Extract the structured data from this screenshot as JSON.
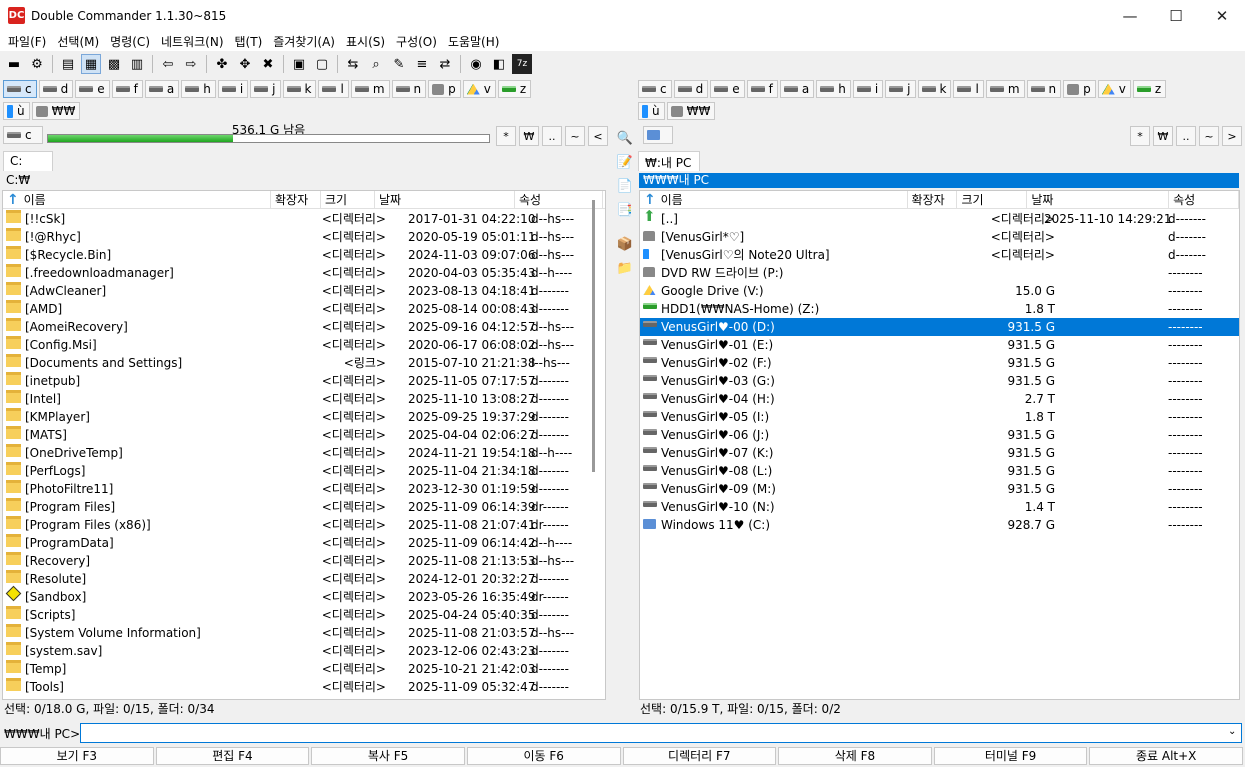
{
  "window": {
    "title": "Double Commander 1.1.30~815",
    "app_icon": "DC"
  },
  "menu": [
    "파일(F)",
    "선택(M)",
    "명령(C)",
    "네트워크(N)",
    "탭(T)",
    "즐겨찾기(A)",
    "표시(S)",
    "구성(O)",
    "도움말(H)"
  ],
  "toolbar_icons": [
    "terminal-icon",
    "settings-icon",
    "brief-view-icon",
    "columns-view-icon",
    "thumbnails-view-icon",
    "flat-view-icon",
    "sync-left-icon",
    "sync-right-icon",
    "copy-icon",
    "move-icon",
    "delete-icon",
    "pack-icon",
    "unpack-icon",
    "compare-icon",
    "search-icon",
    "edit-icon",
    "multi-rename-icon",
    "sync-dirs-icon",
    "torrent-icon",
    "notes-icon",
    "7zip-icon"
  ],
  "left": {
    "drives_row1": [
      {
        "label": "c",
        "sel": true
      },
      {
        "label": "d"
      },
      {
        "label": "e"
      },
      {
        "label": "f"
      },
      {
        "label": "a"
      },
      {
        "label": "h"
      },
      {
        "label": "i"
      },
      {
        "label": "j"
      },
      {
        "label": "k"
      },
      {
        "label": "l"
      },
      {
        "label": "m"
      },
      {
        "label": "n"
      },
      {
        "label": "p",
        "icon": "net"
      },
      {
        "label": "v",
        "icon": "gd"
      },
      {
        "label": "z",
        "icon": "green"
      }
    ],
    "drives_row2": [
      {
        "label": "ù",
        "icon": "usb"
      },
      {
        "label": "₩₩",
        "icon": "net"
      }
    ],
    "current_drive": "c",
    "free_space": "536.1 G 남음",
    "free_fraction": 0.42,
    "path_buttons": [
      "*",
      "₩",
      "..",
      "~",
      "<"
    ],
    "tab": "C:",
    "current_path": "C:₩",
    "columns": [
      "이름",
      "확장자",
      "크기",
      "날짜",
      "속성"
    ],
    "rows": [
      {
        "name": "[!!cSk]",
        "size": "<디렉터리>",
        "date": "2017-01-31 04:22:10",
        "attr": "d--hs---"
      },
      {
        "name": "[!@Rhyc]",
        "size": "<디렉터리>",
        "date": "2020-05-19 05:01:11",
        "attr": "d--hs---"
      },
      {
        "name": "[$Recycle.Bin]",
        "size": "<디렉터리>",
        "date": "2024-11-03 09:07:06",
        "attr": "d--hs---"
      },
      {
        "name": "[.freedownloadmanager]",
        "size": "<디렉터리>",
        "date": "2020-04-03 05:35:43",
        "attr": "d--h----"
      },
      {
        "name": "[AdwCleaner]",
        "size": "<디렉터리>",
        "date": "2023-08-13 04:18:41",
        "attr": "d-------"
      },
      {
        "name": "[AMD]",
        "size": "<디렉터리>",
        "date": "2025-08-14 00:08:43",
        "attr": "d-------"
      },
      {
        "name": "[AomeiRecovery]",
        "size": "<디렉터리>",
        "date": "2025-09-16 04:12:57",
        "attr": "d--hs---"
      },
      {
        "name": "[Config.Msi]",
        "size": "<디렉터리>",
        "date": "2020-06-17 06:08:02",
        "attr": "d--hs---"
      },
      {
        "name": "[Documents and Settings]",
        "size": "<링크>",
        "date": "2015-07-10 21:21:38",
        "attr": "l--hs---"
      },
      {
        "name": "[inetpub]",
        "size": "<디렉터리>",
        "date": "2025-11-05 07:17:57",
        "attr": "d-------"
      },
      {
        "name": "[Intel]",
        "size": "<디렉터리>",
        "date": "2025-11-10 13:08:27",
        "attr": "d-------"
      },
      {
        "name": "[KMPlayer]",
        "size": "<디렉터리>",
        "date": "2025-09-25 19:37:29",
        "attr": "d-------"
      },
      {
        "name": "[MATS]",
        "size": "<디렉터리>",
        "date": "2025-04-04 02:06:27",
        "attr": "d-------"
      },
      {
        "name": "[OneDriveTemp]",
        "size": "<디렉터리>",
        "date": "2024-11-21 19:54:18",
        "attr": "d--h----"
      },
      {
        "name": "[PerfLogs]",
        "size": "<디렉터리>",
        "date": "2025-11-04 21:34:18",
        "attr": "d-------"
      },
      {
        "name": "[PhotoFiltre11]",
        "size": "<디렉터리>",
        "date": "2023-12-30 01:19:59",
        "attr": "d-------"
      },
      {
        "name": "[Program Files]",
        "size": "<디렉터리>",
        "date": "2025-11-09 06:14:39",
        "attr": "dr------"
      },
      {
        "name": "[Program Files (x86)]",
        "size": "<디렉터리>",
        "date": "2025-11-08 21:07:41",
        "attr": "dr------"
      },
      {
        "name": "[ProgramData]",
        "size": "<디렉터리>",
        "date": "2025-11-09 06:14:42",
        "attr": "d--h----"
      },
      {
        "name": "[Recovery]",
        "size": "<디렉터리>",
        "date": "2025-11-08 21:13:53",
        "attr": "d--hs---"
      },
      {
        "name": "[Resolute]",
        "size": "<디렉터리>",
        "date": "2024-12-01 20:32:27",
        "attr": "d-------"
      },
      {
        "name": "[Sandbox]",
        "size": "<디렉터리>",
        "date": "2023-05-26 16:35:49",
        "attr": "dr------",
        "icon": "sandbox"
      },
      {
        "name": "[Scripts]",
        "size": "<디렉터리>",
        "date": "2025-04-24 05:40:35",
        "attr": "d-------"
      },
      {
        "name": "[System Volume Information]",
        "size": "<디렉터리>",
        "date": "2025-11-08 21:03:57",
        "attr": "d--hs---"
      },
      {
        "name": "[system.sav]",
        "size": "<디렉터리>",
        "date": "2023-12-06 02:43:23",
        "attr": "d-------"
      },
      {
        "name": "[Temp]",
        "size": "<디렉터리>",
        "date": "2025-10-21 21:42:03",
        "attr": "d-------"
      },
      {
        "name": "[Tools]",
        "size": "<디렉터리>",
        "date": "2025-11-09 05:32:47",
        "attr": "d-------"
      }
    ],
    "status": "선택: 0/18.0 G, 파일: 0/15, 폴더: 0/34"
  },
  "right": {
    "drives_row1": [
      {
        "label": "c"
      },
      {
        "label": "d"
      },
      {
        "label": "e"
      },
      {
        "label": "f"
      },
      {
        "label": "a"
      },
      {
        "label": "h"
      },
      {
        "label": "i"
      },
      {
        "label": "j"
      },
      {
        "label": "k"
      },
      {
        "label": "l"
      },
      {
        "label": "m"
      },
      {
        "label": "n"
      },
      {
        "label": "p",
        "icon": "net"
      },
      {
        "label": "v",
        "icon": "gd"
      },
      {
        "label": "z",
        "icon": "green"
      }
    ],
    "drives_row2": [
      {
        "label": "ù",
        "icon": "usb"
      },
      {
        "label": "₩₩",
        "icon": "net"
      }
    ],
    "path_buttons": [
      "*",
      "₩",
      "..",
      "~",
      ">"
    ],
    "tab": "₩:내 PC",
    "current_path": "₩₩₩내 PC",
    "columns": [
      "이름",
      "확장자",
      "크기",
      "날짜",
      "속성"
    ],
    "rows": [
      {
        "name": "[..]",
        "size": "<디렉터리>",
        "date": "2025-11-10 14:29:21",
        "attr": "d-------",
        "icon": "up"
      },
      {
        "name": "[VenusGirl*♡]",
        "size": "<디렉터리>",
        "date": "",
        "attr": "d-------",
        "icon": "net"
      },
      {
        "name": "[VenusGirl♡의 Note20 Ultra]",
        "size": "<디렉터리>",
        "date": "",
        "attr": "d-------",
        "icon": "usb"
      },
      {
        "name": "DVD RW 드라이브 (P:)",
        "size": "",
        "date": "",
        "attr": "--------",
        "icon": "net"
      },
      {
        "name": "Google Drive (V:)",
        "size": "15.0 G",
        "date": "",
        "attr": "--------",
        "icon": "gd"
      },
      {
        "name": "HDD1(₩₩NAS-Home) (Z:)",
        "size": "1.8 T",
        "date": "",
        "attr": "--------",
        "icon": "green"
      },
      {
        "name": "VenusGirl♥-00 (D:)",
        "size": "931.5 G",
        "date": "",
        "attr": "--------",
        "icon": "drive",
        "sel": true
      },
      {
        "name": "VenusGirl♥-01 (E:)",
        "size": "931.5 G",
        "date": "",
        "attr": "--------",
        "icon": "drive"
      },
      {
        "name": "VenusGirl♥-02 (F:)",
        "size": "931.5 G",
        "date": "",
        "attr": "--------",
        "icon": "drive"
      },
      {
        "name": "VenusGirl♥-03 (G:)",
        "size": "931.5 G",
        "date": "",
        "attr": "--------",
        "icon": "drive"
      },
      {
        "name": "VenusGirl♥-04 (H:)",
        "size": "2.7 T",
        "date": "",
        "attr": "--------",
        "icon": "drive"
      },
      {
        "name": "VenusGirl♥-05 (I:)",
        "size": "1.8 T",
        "date": "",
        "attr": "--------",
        "icon": "drive"
      },
      {
        "name": "VenusGirl♥-06 (J:)",
        "size": "931.5 G",
        "date": "",
        "attr": "--------",
        "icon": "drive"
      },
      {
        "name": "VenusGirl♥-07 (K:)",
        "size": "931.5 G",
        "date": "",
        "attr": "--------",
        "icon": "drive"
      },
      {
        "name": "VenusGirl♥-08 (L:)",
        "size": "931.5 G",
        "date": "",
        "attr": "--------",
        "icon": "drive"
      },
      {
        "name": "VenusGirl♥-09 (M:)",
        "size": "931.5 G",
        "date": "",
        "attr": "--------",
        "icon": "drive"
      },
      {
        "name": "VenusGirl♥-10 (N:)",
        "size": "1.4 T",
        "date": "",
        "attr": "--------",
        "icon": "drive"
      },
      {
        "name": "Windows 11♥ (C:)",
        "size": "928.7 G",
        "date": "",
        "attr": "--------",
        "icon": "pc"
      }
    ],
    "status": "선택: 0/15.9 T, 파일: 0/15, 폴더: 0/2"
  },
  "command_line": {
    "label": "₩₩₩내 PC>",
    "value": ""
  },
  "fkeys": [
    "보기 F3",
    "편집 F4",
    "복사 F5",
    "이동 F6",
    "디렉터리 F7",
    "삭제 F8",
    "터미널 F9",
    "종료 Alt+X"
  ]
}
